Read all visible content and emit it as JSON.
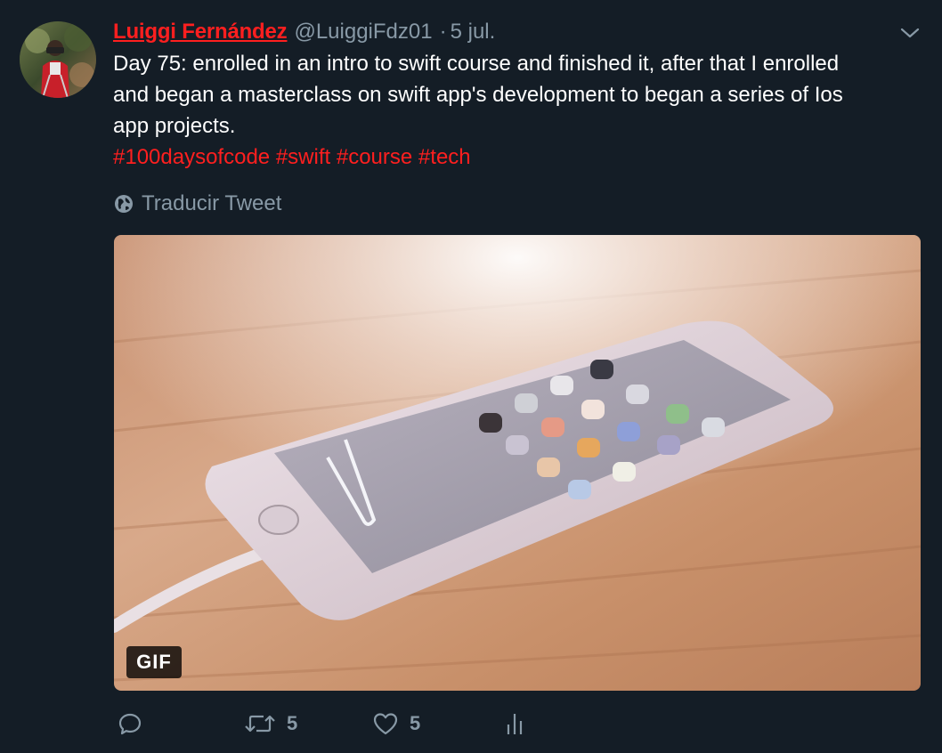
{
  "tweet": {
    "author_name": "Luiggi Fernández",
    "handle": "@LuiggiFdz01",
    "separator": "·",
    "date": "5 jul.",
    "text_line1": "Day 75: enrolled in an intro to swift course and finished it, after that I enrolled",
    "text_line2": "and began a masterclass on swift app's development to began a series of Ios",
    "text_line3": "app projects.",
    "hashtags": [
      "#100daysofcode",
      "#swift",
      "#course",
      "#tech"
    ],
    "translate_label": "Traducir Tweet",
    "media_badge": "GIF"
  },
  "actions": {
    "reply_count": "",
    "retweet_count": "5",
    "like_count": "5"
  },
  "colors": {
    "background": "#141d26",
    "accent": "#ff1f1f",
    "muted": "#8899a6",
    "text": "#ffffff"
  },
  "icons": {
    "caret": "chevron-down-icon",
    "translate": "globe-icon",
    "reply": "reply-icon",
    "retweet": "retweet-icon",
    "like": "heart-icon",
    "analytics": "analytics-icon"
  }
}
